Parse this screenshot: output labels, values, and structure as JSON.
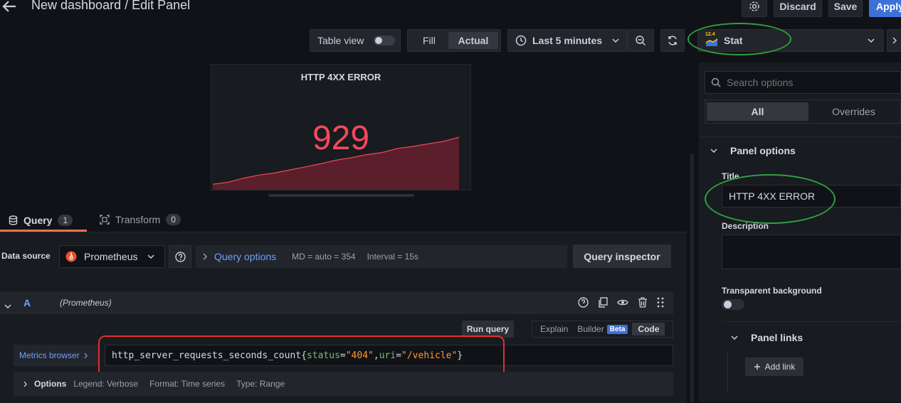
{
  "header": {
    "title": "New dashboard / Edit Panel",
    "discard_label": "Discard",
    "save_label": "Save",
    "apply_label": "Apply"
  },
  "toolbar": {
    "table_view_label": "Table view",
    "fill_label": "Fill",
    "actual_label": "Actual",
    "time_range_label": "Last 5 minutes",
    "viz_icon_text": "12.4",
    "viz_label": "Stat"
  },
  "panel": {
    "title": "HTTP 4XX ERROR",
    "value": "929",
    "sparkline": [
      0.08,
      0.12,
      0.2,
      0.26,
      0.3,
      0.36,
      0.42,
      0.48,
      0.55,
      0.6,
      0.66,
      0.7,
      0.78,
      0.82,
      0.87,
      0.92,
      1.0
    ]
  },
  "tabs": {
    "query_label": "Query",
    "query_count": "1",
    "transform_label": "Transform",
    "transform_count": "0"
  },
  "datasource": {
    "label": "Data source",
    "name": "Prometheus",
    "query_options_label": "Query options",
    "md_text": "MD = auto = 354",
    "interval_text": "Interval = 15s",
    "inspector_label": "Query inspector"
  },
  "query": {
    "ref": "A",
    "ds_hint": "(Prometheus)",
    "run_label": "Run query",
    "explain_label": "Explain",
    "builder_label": "Builder",
    "beta_label": "Beta",
    "code_label": "Code",
    "metrics_browser_label": "Metrics browser",
    "expr_metric": "http_server_requests_seconds_count",
    "expr_open": "{",
    "expr_key1": "status",
    "expr_eq1": "=",
    "expr_val1": "\"404\"",
    "expr_comma": ",",
    "expr_key2": "uri",
    "expr_eq2": "=",
    "expr_val2": "\"/vehicle\"",
    "expr_close": "}",
    "options_label": "Options",
    "legend_text": "Legend: Verbose",
    "format_text": "Format: Time series",
    "type_text": "Type: Range"
  },
  "options_pane": {
    "search_placeholder": "Search options",
    "tab_all": "All",
    "tab_overrides": "Overrides",
    "section_panel_options": "Panel options",
    "title_label": "Title",
    "title_value": "HTTP 4XX ERROR",
    "description_label": "Description",
    "transparent_label": "Transparent background",
    "panel_links_label": "Panel links",
    "add_link_label": "Add link"
  }
}
